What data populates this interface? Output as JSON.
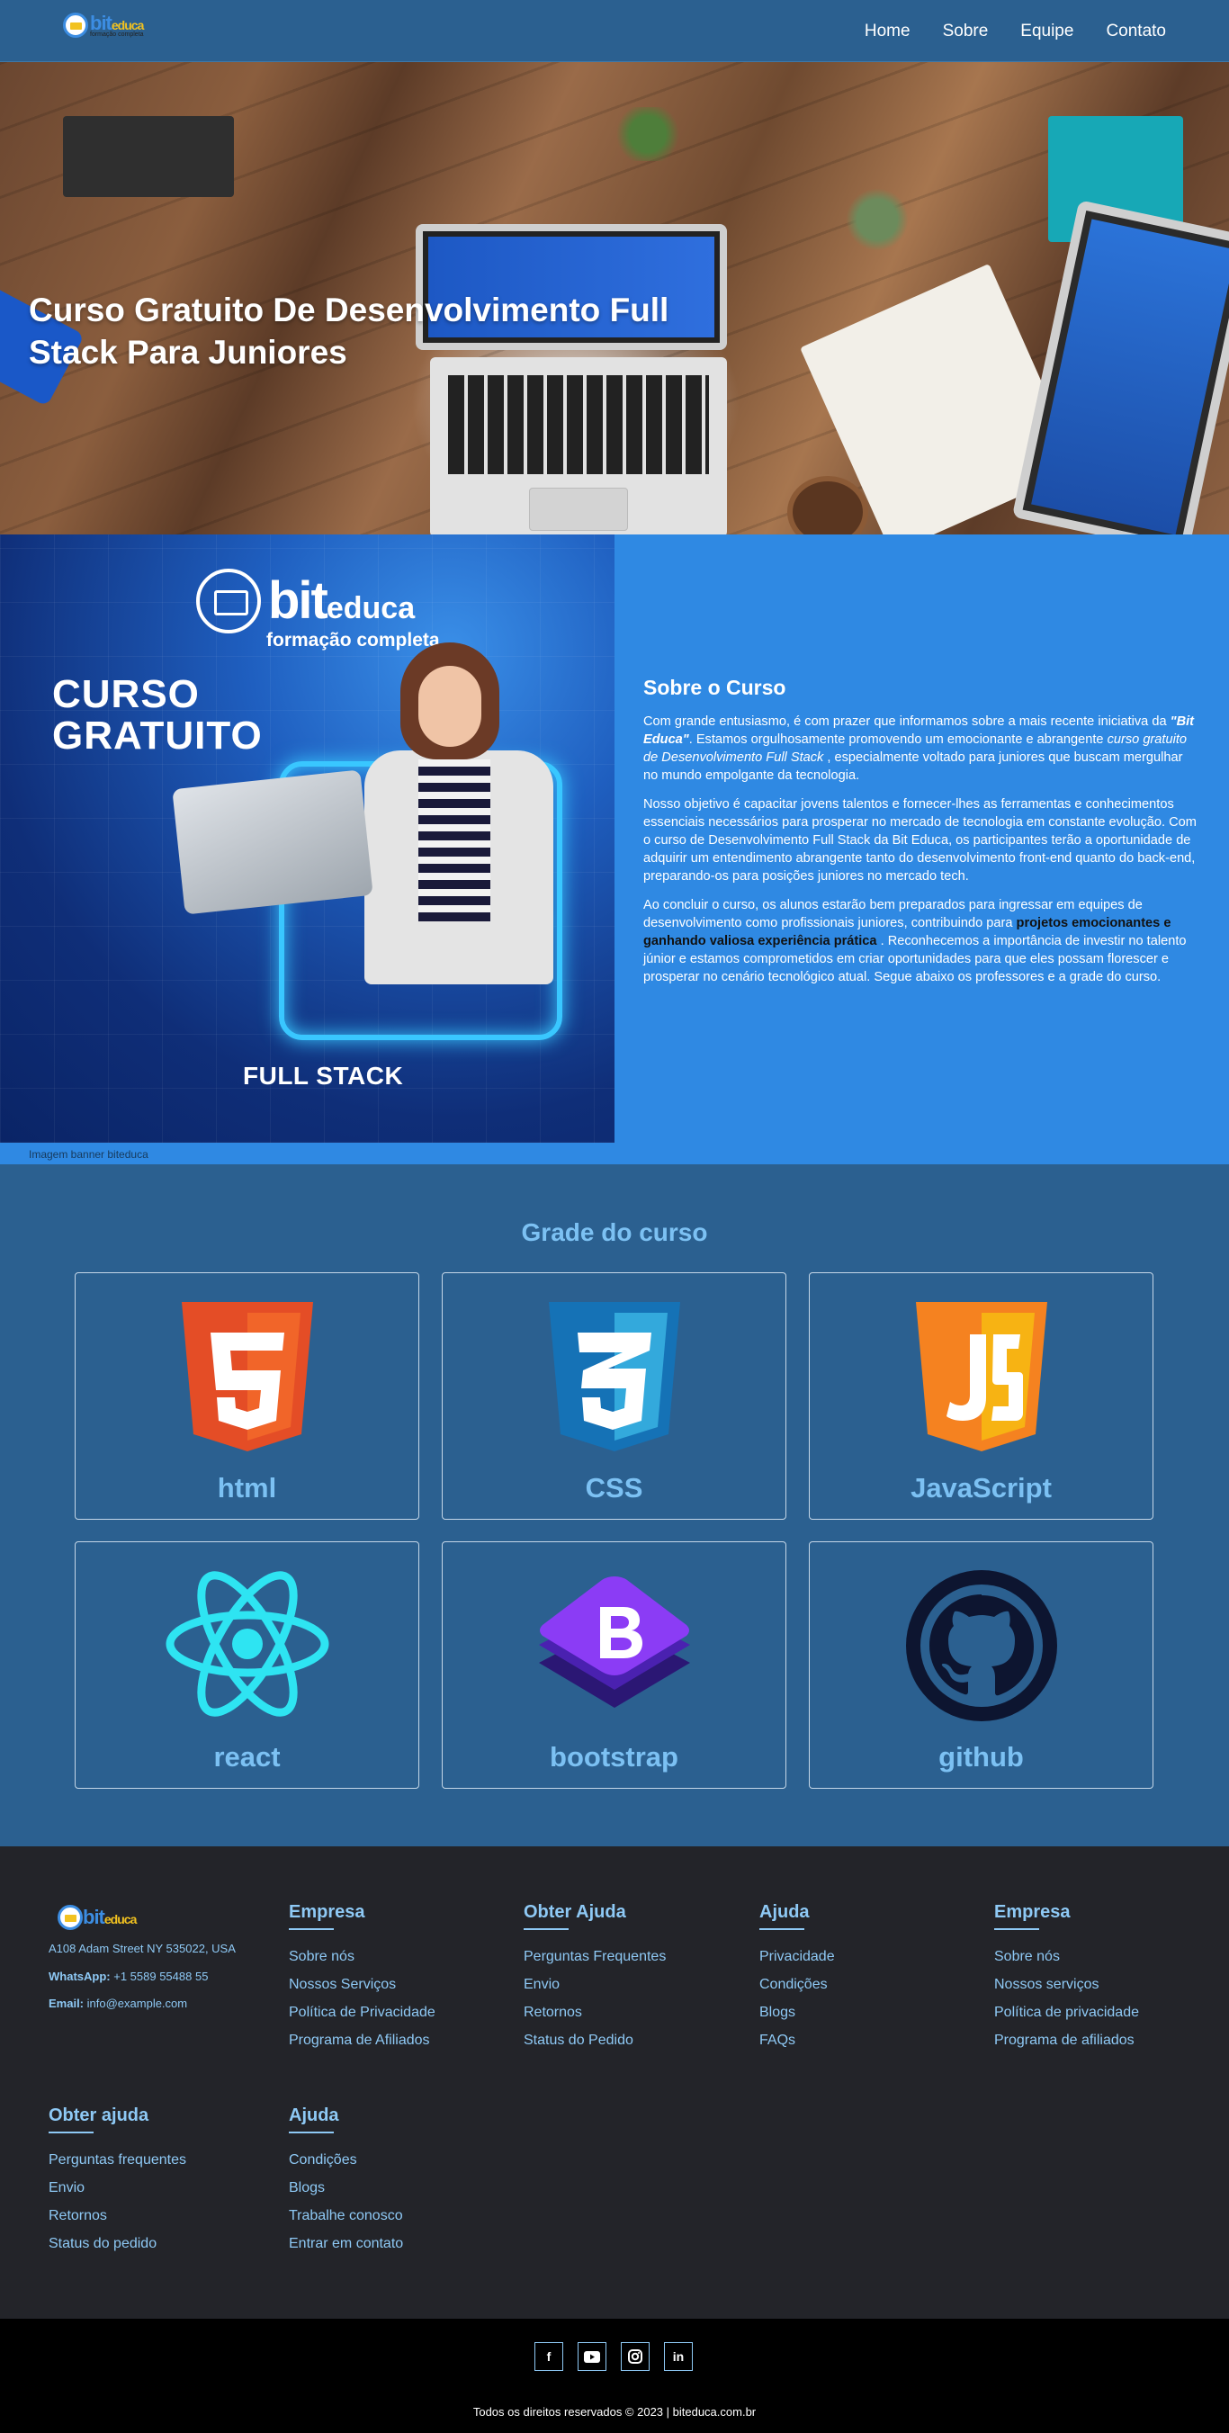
{
  "nav": {
    "logo_word_a": "bit",
    "logo_word_b": "educa",
    "logo_sub": "formação completa",
    "links": [
      "Home",
      "Sobre",
      "Equipe",
      "Contato"
    ]
  },
  "hero": {
    "title": "Curso Gratuito De Desenvolvimento Full Stack Para Juniores"
  },
  "banner": {
    "logo_a": "bit",
    "logo_b": "educa",
    "logo_sub": "formação completa",
    "course_line1": "CURSO",
    "course_line2": "GRATUITO",
    "full_stack": "FULL STACK",
    "caption": "Imagem banner biteduca"
  },
  "about": {
    "heading": "Sobre o Curso",
    "p1_a": "Com grande entusiasmo, é com prazer que informamos sobre a mais recente iniciativa da ",
    "p1_brand": "\"Bit Educa\"",
    "p1_b": ". Estamos orgulhosamente promovendo um emocionante e abrangente ",
    "p1_em": "curso gratuito de Desenvolvimento Full Stack",
    "p1_c": " , especialmente voltado para juniores que buscam mergulhar no mundo empolgante da tecnologia.",
    "p2": "Nosso objetivo é capacitar jovens talentos e fornecer-lhes as ferramentas e conhecimentos essenciais necessários para prosperar no mercado de tecnologia em constante evolução. Com o curso de Desenvolvimento Full Stack da Bit Educa, os participantes terão a oportunidade de adquirir um entendimento abrangente tanto do desenvolvimento front-end quanto do back-end, preparando-os para posições juniores no mercado tech.",
    "p3_a": "Ao concluir o curso, os alunos estarão bem preparados para ingressar em equipes de desenvolvimento como profissionais juniores, contribuindo para ",
    "p3_hl": "projetos emocionantes e ganhando valiosa experiência prática",
    "p3_b": " . Reconhecemos a importância de investir no talento júnior e estamos comprometidos em criar oportunidades para que eles possam florescer e prosperar no cenário tecnológico atual. Segue abaixo os professores e a grade do curso."
  },
  "grade": {
    "title": "Grade do curso",
    "cards": [
      {
        "label": "html",
        "icon": "html5-icon",
        "color": "#e44d26"
      },
      {
        "label": "CSS",
        "icon": "css3-icon",
        "color": "#1572b6"
      },
      {
        "label": "JavaScript",
        "icon": "javascript-icon",
        "color": "#f7df1e"
      },
      {
        "label": "react",
        "icon": "react-icon",
        "color": "#2ee4f2"
      },
      {
        "label": "bootstrap",
        "icon": "bootstrap-icon",
        "color": "#7952b3"
      },
      {
        "label": "github",
        "icon": "github-icon",
        "color": "#0d1530"
      }
    ]
  },
  "footer": {
    "logo_a": "bit",
    "logo_b": "educa",
    "address": "A108 Adam Street NY 535022, USA",
    "whatsapp_label": "WhatsApp:",
    "whatsapp": "+1 5589 55488 55",
    "email_label": "Email:",
    "email": "info@example.com",
    "columns": [
      {
        "title": "Empresa",
        "links": [
          "Sobre nós",
          "Nossos Serviços",
          "Política de Privacidade",
          "Programa de Afiliados"
        ]
      },
      {
        "title": "Obter Ajuda",
        "links": [
          "Perguntas Frequentes",
          "Envio",
          "Retornos",
          "Status do Pedido"
        ]
      },
      {
        "title": "Ajuda",
        "links": [
          "Privacidade",
          "Condições",
          "Blogs",
          "FAQs"
        ]
      },
      {
        "title": "Empresa",
        "links": [
          "Sobre nós",
          "Nossos serviços",
          "Política de privacidade",
          "Programa de afiliados"
        ]
      },
      {
        "title": "Obter ajuda",
        "links": [
          "Perguntas frequentes",
          "Envio",
          "Retornos",
          "Status do pedido"
        ]
      },
      {
        "title": "Ajuda",
        "links": [
          "Condições",
          "Blogs",
          "Trabalhe conosco",
          "Entrar em contato"
        ]
      }
    ],
    "socials": [
      "facebook-icon",
      "youtube-icon",
      "instagram-icon",
      "linkedin-icon"
    ],
    "copyright": "Todos os direitos reservados © 2023 | biteduca.com.br"
  }
}
